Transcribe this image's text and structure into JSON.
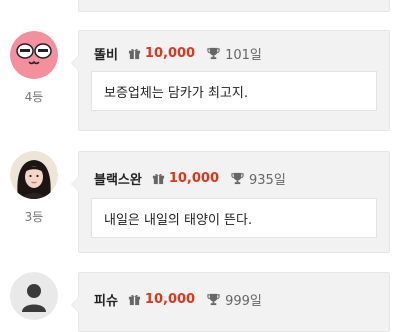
{
  "entries": [
    {
      "nickname": "똘비",
      "points": "10,000",
      "days": "101일",
      "message": "보증업체는 담카가 최고지.",
      "rank": "4등",
      "avatar": "pink-face-avatar"
    },
    {
      "nickname": "블랙스완",
      "points": "10,000",
      "days": "935일",
      "message": "내일은 내일의 태양이 뜬다.",
      "rank": "3등",
      "avatar": "photo-avatar"
    },
    {
      "nickname": "피슈",
      "points": "10,000",
      "days": "999일",
      "avatar": "default-user-avatar"
    }
  ],
  "colors": {
    "points": "#d6391e",
    "card_bg": "#f2f2f2",
    "avatar_pink": "#f48f9e"
  },
  "icons": {
    "points": "gift-icon",
    "days": "trophy-icon"
  }
}
